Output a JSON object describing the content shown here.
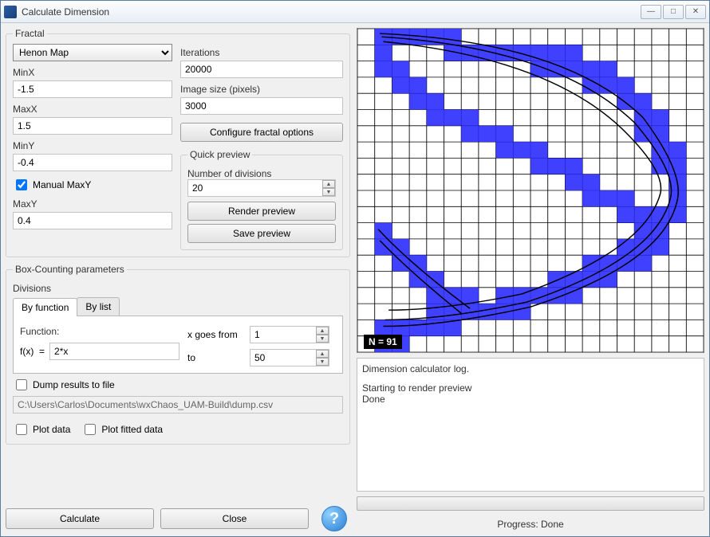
{
  "window": {
    "title": "Calculate Dimension"
  },
  "fractal": {
    "legend": "Fractal",
    "type_options": [
      "Henon Map"
    ],
    "type_selected": "Henon Map",
    "minx_label": "MinX",
    "minx": "-1.5",
    "maxx_label": "MaxX",
    "maxx": "1.5",
    "miny_label": "MinY",
    "miny": "-0.4",
    "manual_maxy_label": "Manual MaxY",
    "manual_maxy_checked": true,
    "maxy_label": "MaxY",
    "maxy": "0.4",
    "iterations_label": "Iterations",
    "iterations": "20000",
    "imagesize_label": "Image size (pixels)",
    "imagesize": "3000",
    "configure_btn": "Configure fractal options",
    "preview_legend": "Quick preview",
    "divisions_label": "Number of divisions",
    "divisions": "20",
    "render_btn": "Render preview",
    "save_btn": "Save preview"
  },
  "boxcount": {
    "legend": "Box-Counting parameters",
    "divisions_label": "Divisions",
    "tab_byfunc": "By function",
    "tab_bylist": "By list",
    "function_label": "Function:",
    "fx_prefix": "f(x)  =",
    "fx_value": "2*x",
    "xfrom_label": "x goes from",
    "xfrom": "1",
    "xto_label": "to",
    "xto": "50",
    "dump_label": "Dump results to file",
    "dump_path": "C:\\Users\\Carlos\\Documents\\wxChaos_UAM-Build\\dump.csv",
    "plot_data_label": "Plot data",
    "plot_fitted_label": "Plot fitted data"
  },
  "buttons": {
    "calculate": "Calculate",
    "close": "Close"
  },
  "preview_panel": {
    "n_label": "N = 91"
  },
  "log": {
    "header": "Dimension calculator log.",
    "line1": "Starting to render preview",
    "line2": "Done"
  },
  "progress": {
    "label": "Progress: Done"
  }
}
